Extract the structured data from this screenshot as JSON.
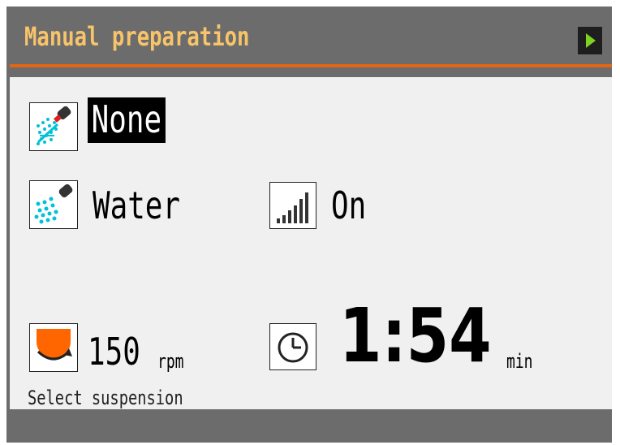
{
  "header": {
    "title": "Manual preparation",
    "next_icon": "play-right-icon"
  },
  "colors": {
    "title": "#f7c46a",
    "accent": "#e26614",
    "frame": "#6c6c6c",
    "panel": "#f0f0f0",
    "next_arrow": "#7ed321"
  },
  "rows": {
    "preparation_mode": {
      "icon": "spray-icon",
      "value": "None",
      "selected": true
    },
    "liquid": {
      "icon": "spray-icon",
      "value": "Water"
    },
    "intensity": {
      "icon": "signal-bars-icon",
      "value": "On"
    },
    "speed": {
      "icon": "rotation-disc-icon",
      "value": "150",
      "unit": "rpm"
    },
    "time": {
      "icon": "clock-icon",
      "value": "1:54",
      "unit": "min"
    }
  },
  "status": "Select suspension"
}
